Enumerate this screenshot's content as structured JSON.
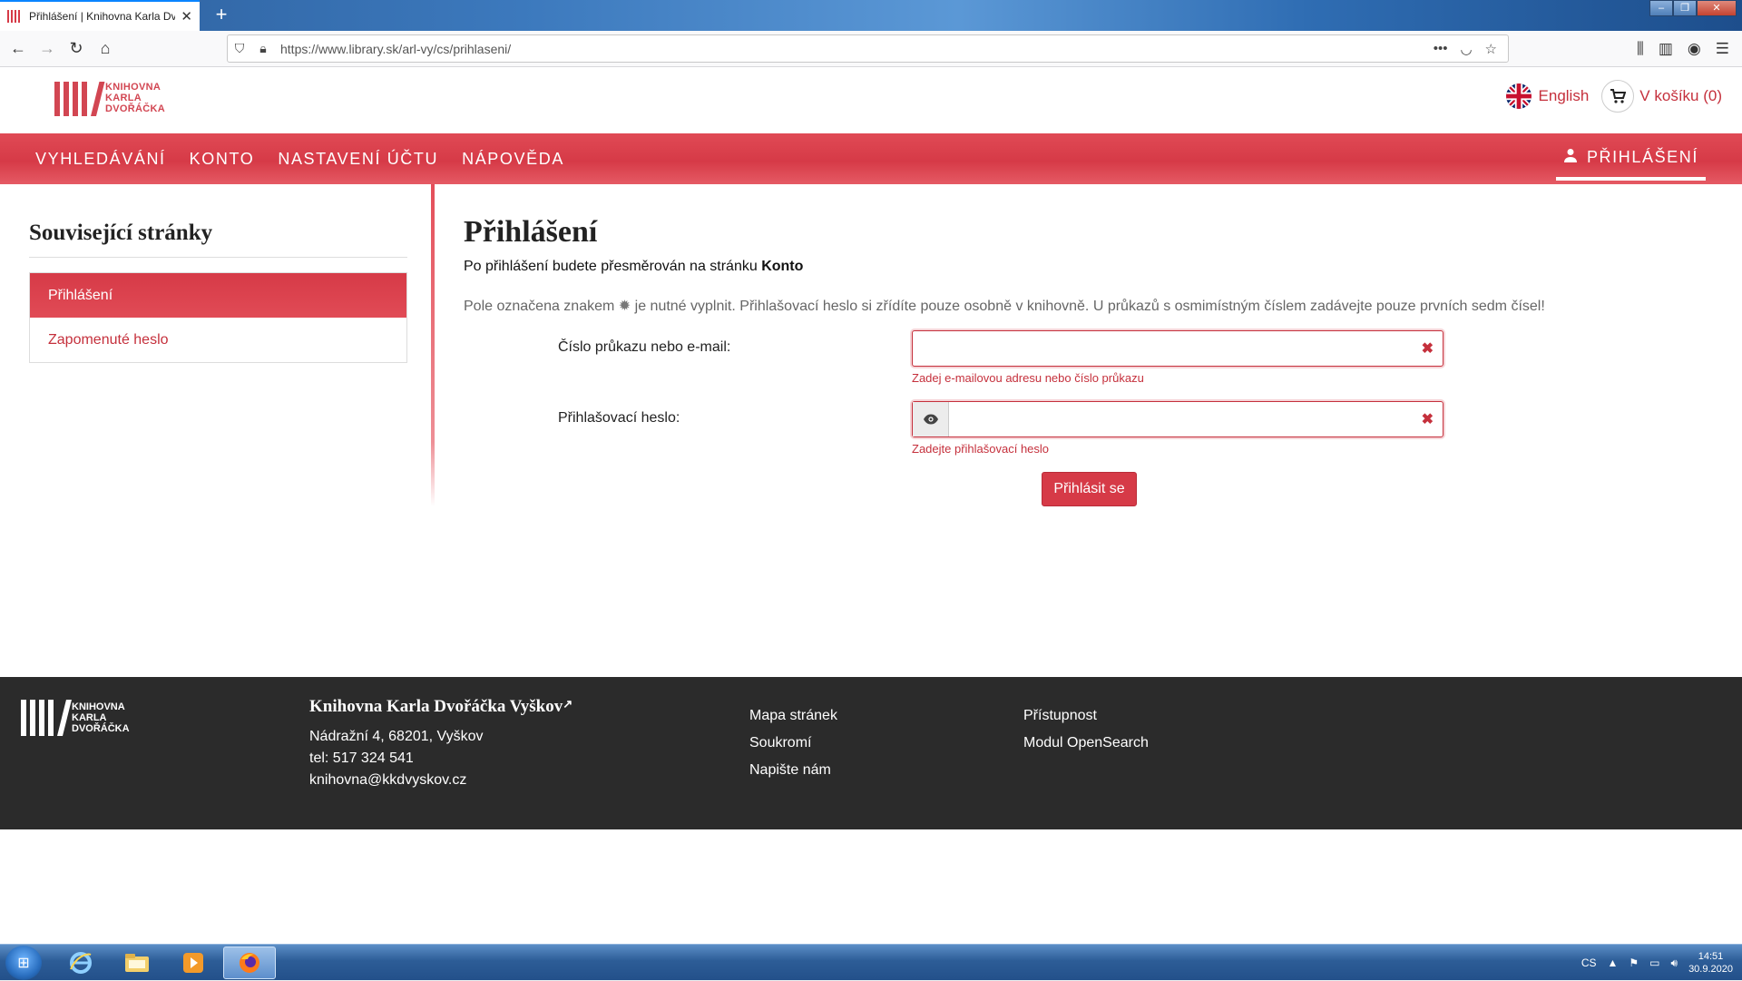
{
  "browser": {
    "tab_title": "Přihlášení | Knihovna Karla Dvo",
    "url": "https://www.library.sk/arl-vy/cs/prihlaseni/"
  },
  "site": {
    "logo_line1": "KNIHOVNA",
    "logo_line2": "KARLA",
    "logo_line3": "DVOŘÁČKA",
    "language": "English",
    "cart": "V košíku (0)"
  },
  "nav": {
    "items": [
      "VYHLEDÁVÁNÍ",
      "KONTO",
      "NASTAVENÍ ÚČTU",
      "NÁPOVĚDA"
    ],
    "login": "PŘIHLÁŠENÍ"
  },
  "sidebar": {
    "title": "Související stránky",
    "items": [
      "Přihlášení",
      "Zapomenuté heslo"
    ]
  },
  "main": {
    "title": "Přihlášení",
    "redirect_prefix": "Po přihlášení budete přesměrován na stránku",
    "redirect_target": "Konto",
    "hint_before": "Pole označena znakem",
    "hint_after": "je nutné vyplnit. Přihlašovací heslo si zřídíte pouze osobně v knihovně. U průkazů s osmimístným číslem zadávejte pouze prvních sedm čísel!",
    "field1_label": "Číslo průkazu nebo e-mail:",
    "field1_value": "",
    "field1_error": "Zadej e-mailovou adresu nebo číslo průkazu",
    "field2_label": "Přihlašovací heslo:",
    "field2_value": "",
    "field2_error": "Zadejte přihlašovací heslo",
    "submit": "Přihlásit se"
  },
  "footer": {
    "library_name": "Knihovna Karla Dvořáčka Vyškov",
    "address": "Nádražní 4, 68201, Vyškov",
    "phone": "tel: 517 324 541",
    "email": "knihovna@kkdvyskov.cz",
    "links_col1": [
      "Mapa stránek",
      "Soukromí",
      "Napište nám"
    ],
    "links_col2": [
      "Přístupnost",
      "Modul OpenSearch"
    ]
  },
  "taskbar": {
    "lang": "CS",
    "time": "14:51",
    "date": "30.9.2020"
  },
  "colors": {
    "brand_red": "#d63a47",
    "footer_bg": "#2b2b2b"
  }
}
